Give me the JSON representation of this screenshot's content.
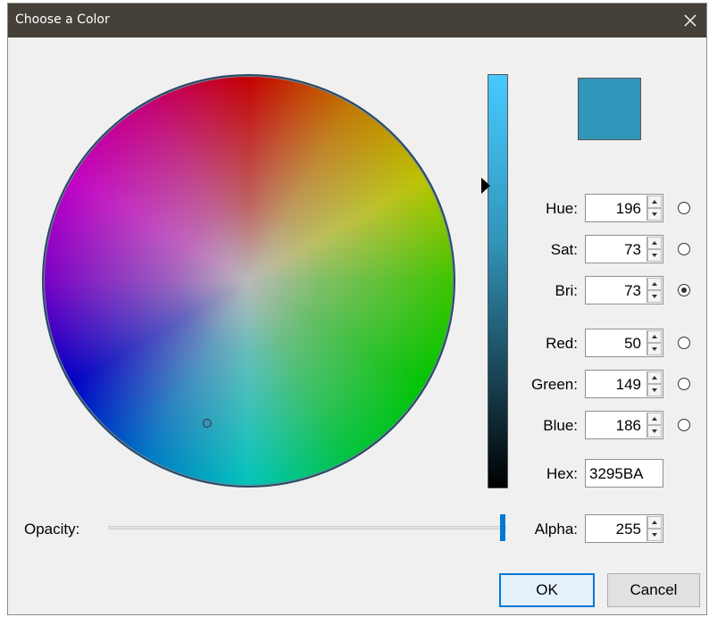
{
  "window": {
    "title": "Choose a Color",
    "close_icon": "close-icon"
  },
  "color": {
    "hex_color": "#3295BA"
  },
  "fields": [
    {
      "key": "hue",
      "label": "Hue:",
      "value": "196",
      "selected": false
    },
    {
      "key": "sat",
      "label": "Sat:",
      "value": "73",
      "selected": false
    },
    {
      "key": "bri",
      "label": "Bri:",
      "value": "73",
      "selected": true
    },
    {
      "key": "red",
      "label": "Red:",
      "value": "50",
      "selected": false
    },
    {
      "key": "green",
      "label": "Green:",
      "value": "149",
      "selected": false
    },
    {
      "key": "blue",
      "label": "Blue:",
      "value": "186",
      "selected": false
    }
  ],
  "hex": {
    "label": "Hex:",
    "value": "3295BA"
  },
  "opacity": {
    "label": "Opacity:",
    "level": 1.0
  },
  "alpha": {
    "label": "Alpha:",
    "value": "255"
  },
  "buttons": {
    "ok": "OK",
    "cancel": "Cancel"
  }
}
